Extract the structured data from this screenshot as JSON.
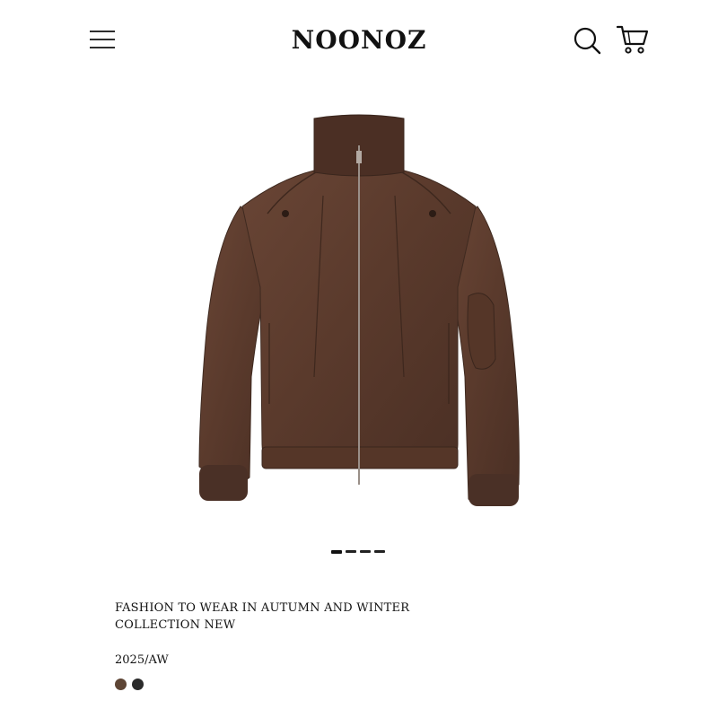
{
  "header": {
    "brand": "NOONOZ",
    "menu_icon": "hamburger-menu-icon",
    "search_icon": "search-icon",
    "cart_icon": "shopping-cart-icon"
  },
  "product": {
    "image_subject": "brown zip-up jacket",
    "jacket_color": "#5a3a2c",
    "headline_line1": "FASHION TO WEAR IN AUTUMN AND WINTER",
    "headline_line2": "COLLECTION NEW",
    "season": "2025/AW",
    "swatches": [
      {
        "name": "brown",
        "color": "#5e4535"
      },
      {
        "name": "black",
        "color": "#2b2b2b"
      }
    ]
  },
  "carousel": {
    "count": 4,
    "active_index": 0
  }
}
